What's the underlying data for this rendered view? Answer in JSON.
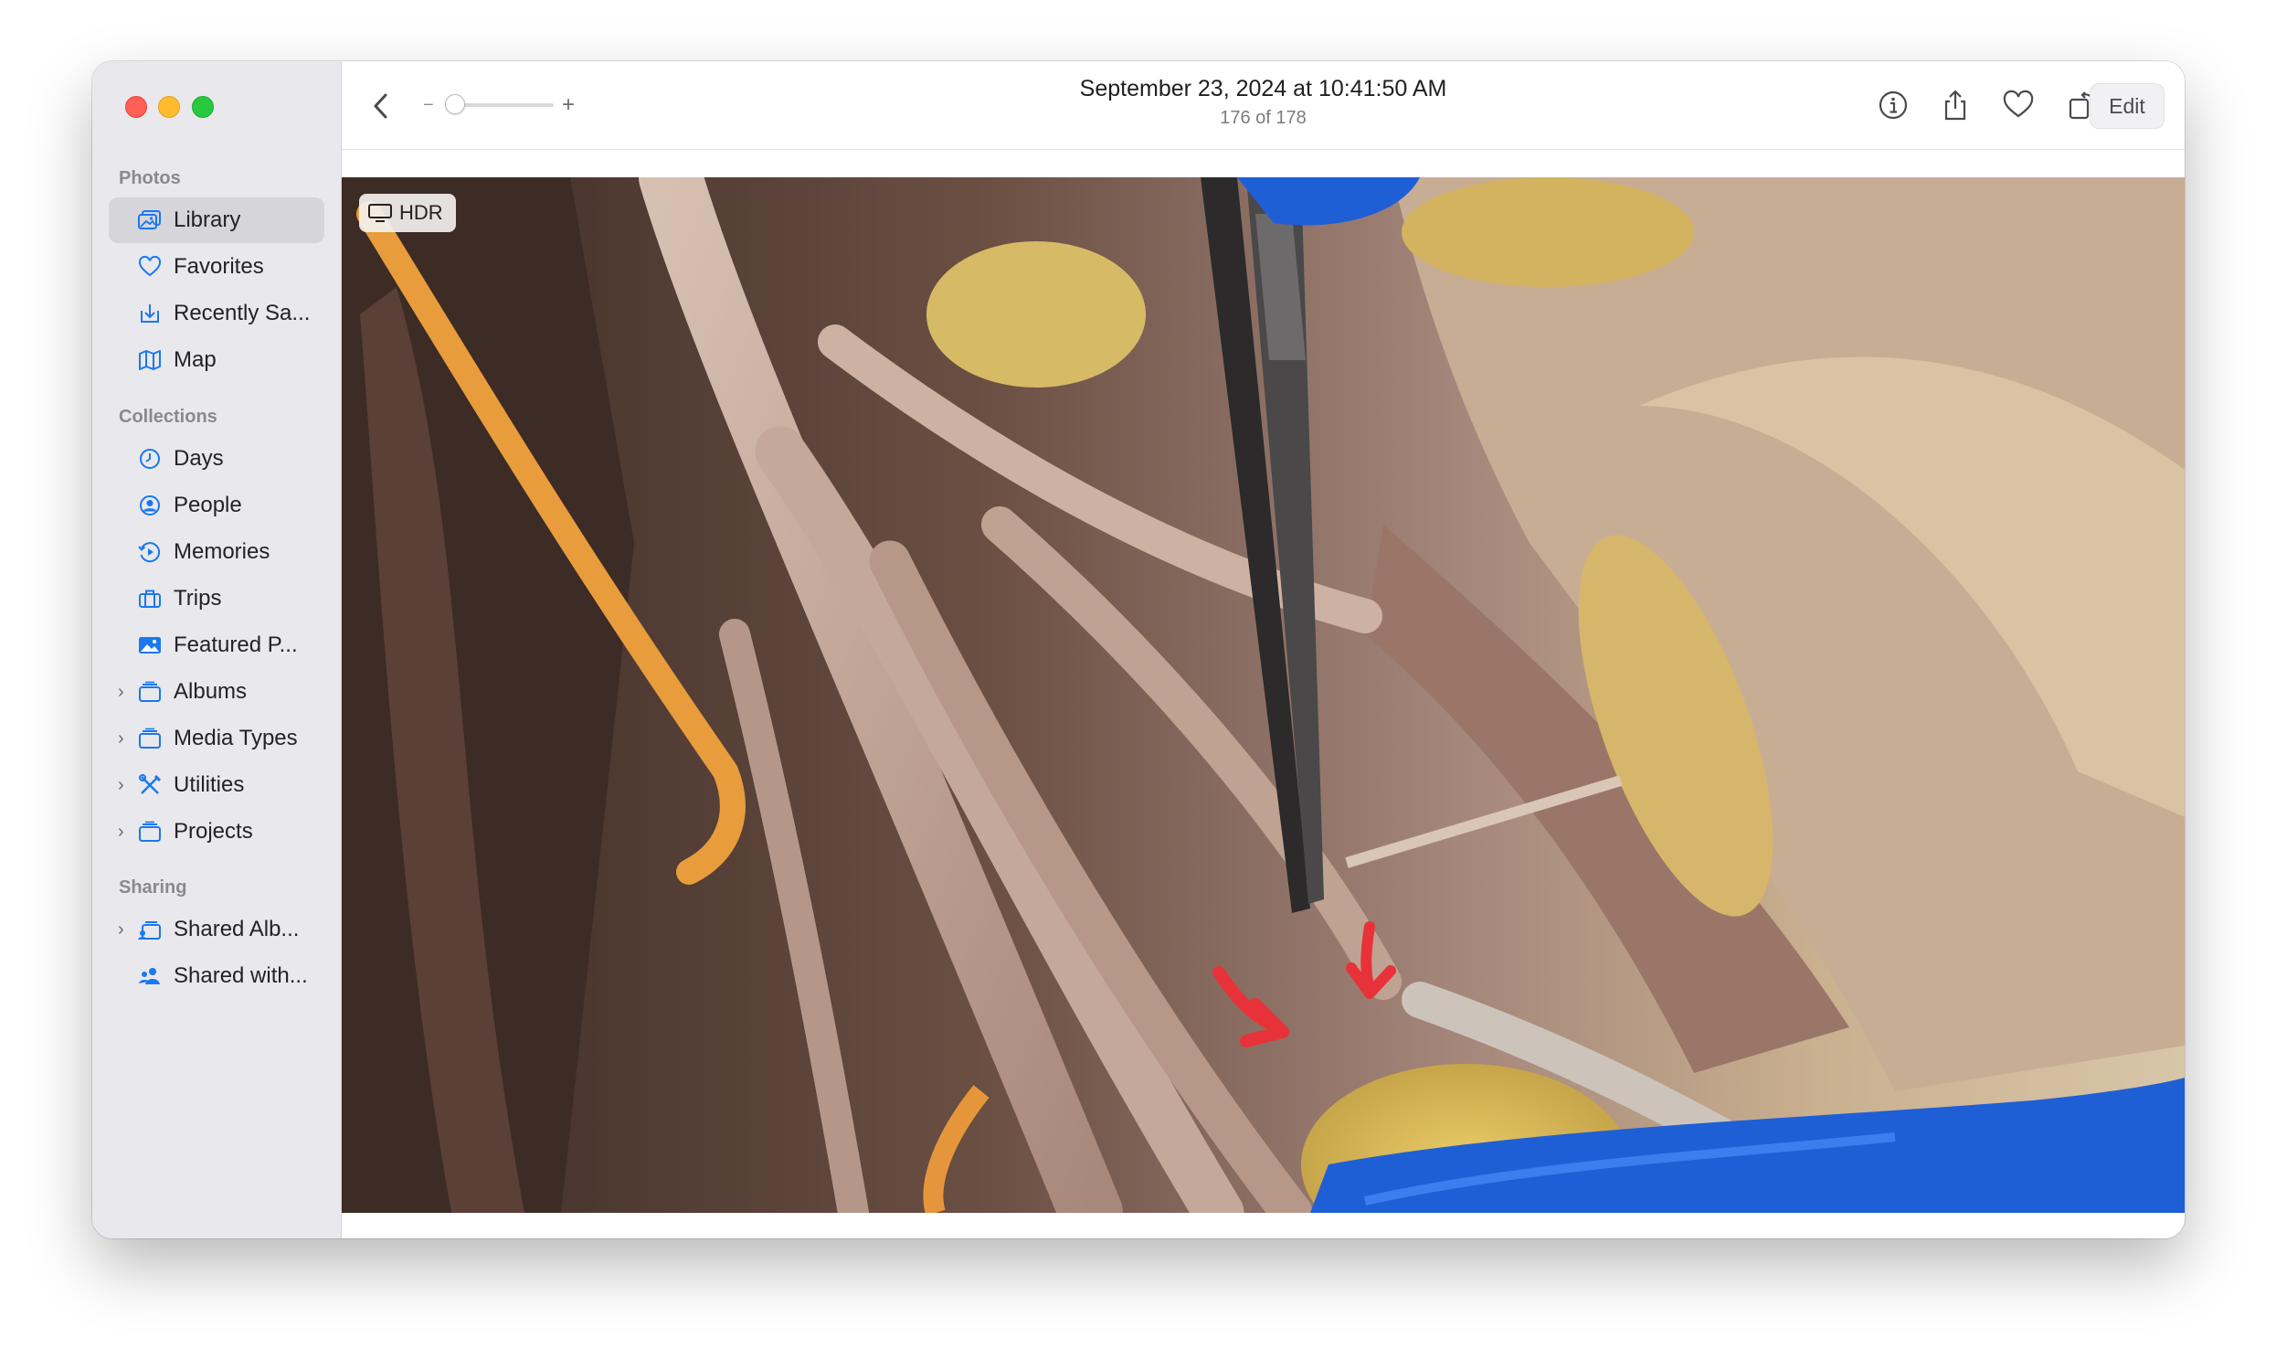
{
  "window": {
    "title_date": "September 23, 2024 at 10:41:50 AM",
    "position_text": "176 of 178",
    "edit_label": "Edit",
    "hdr_label": "HDR"
  },
  "sidebar": {
    "sections": [
      {
        "header": "Photos",
        "items": [
          {
            "label": "Library",
            "icon": "library-icon",
            "selected": true,
            "expandable": false
          },
          {
            "label": "Favorites",
            "icon": "heart-icon",
            "selected": false,
            "expandable": false
          },
          {
            "label": "Recently Sa...",
            "icon": "recently-saved-icon",
            "selected": false,
            "expandable": false
          },
          {
            "label": "Map",
            "icon": "map-icon",
            "selected": false,
            "expandable": false
          }
        ]
      },
      {
        "header": "Collections",
        "items": [
          {
            "label": "Days",
            "icon": "clock-icon",
            "selected": false,
            "expandable": false
          },
          {
            "label": "People",
            "icon": "person-circle-icon",
            "selected": false,
            "expandable": false
          },
          {
            "label": "Memories",
            "icon": "memories-icon",
            "selected": false,
            "expandable": false
          },
          {
            "label": "Trips",
            "icon": "suitcase-icon",
            "selected": false,
            "expandable": false
          },
          {
            "label": "Featured P...",
            "icon": "photo-icon",
            "selected": false,
            "expandable": false
          },
          {
            "label": "Albums",
            "icon": "stack-icon",
            "selected": false,
            "expandable": true
          },
          {
            "label": "Media Types",
            "icon": "stack-icon",
            "selected": false,
            "expandable": true
          },
          {
            "label": "Utilities",
            "icon": "tools-icon",
            "selected": false,
            "expandable": true
          },
          {
            "label": "Projects",
            "icon": "stack-icon",
            "selected": false,
            "expandable": true
          }
        ]
      },
      {
        "header": "Sharing",
        "items": [
          {
            "label": "Shared Alb...",
            "icon": "shared-album-icon",
            "selected": false,
            "expandable": true
          },
          {
            "label": "Shared with...",
            "icon": "shared-with-you-icon",
            "selected": false,
            "expandable": false
          }
        ]
      }
    ]
  },
  "colors": {
    "accent": "#1a78f0",
    "sidebar_bg": "#e9e8ec",
    "selected_bg": "#d6d5da",
    "annotation_arrow": "#e8323a",
    "glove_blue": "#1f5fd6"
  },
  "toolbar_icons": [
    "back-chevron-icon",
    "info-icon",
    "share-icon",
    "heart-icon",
    "rotate-icon",
    "magic-wand-icon"
  ]
}
